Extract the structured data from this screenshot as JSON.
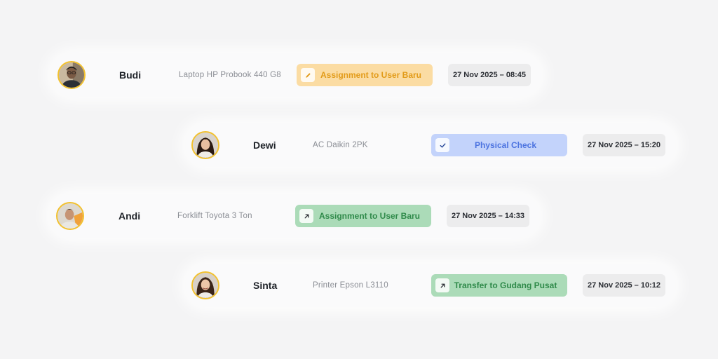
{
  "activity_log": [
    {
      "user": "Budi",
      "asset": "Laptop HP Probook 440 G8",
      "action": "Assignment to User Baru",
      "action_icon": "pencil-icon",
      "action_color": "#e29b19",
      "timestamp": "27 Nov 2025 – 08:45"
    },
    {
      "user": "Dewi",
      "asset": "AC Daikin 2PK",
      "action": "Physical Check",
      "action_icon": "check-icon",
      "action_color": "#4d74e0",
      "timestamp": "27 Nov 2025 – 15:20"
    },
    {
      "user": "Andi",
      "asset": "Forklift Toyota 3 Ton",
      "action": "Assignment to User Baru",
      "action_icon": "arrow-up-right-icon",
      "action_color": "#2f8a4a",
      "timestamp": "27 Nov 2025 – 14:33"
    },
    {
      "user": "Sinta",
      "asset": "Printer Epson L3110",
      "action": "Transfer to Gudang Pusat",
      "action_icon": "arrow-up-right-icon",
      "action_color": "#2f8a4a",
      "timestamp": "27 Nov 2025 – 10:12"
    }
  ]
}
